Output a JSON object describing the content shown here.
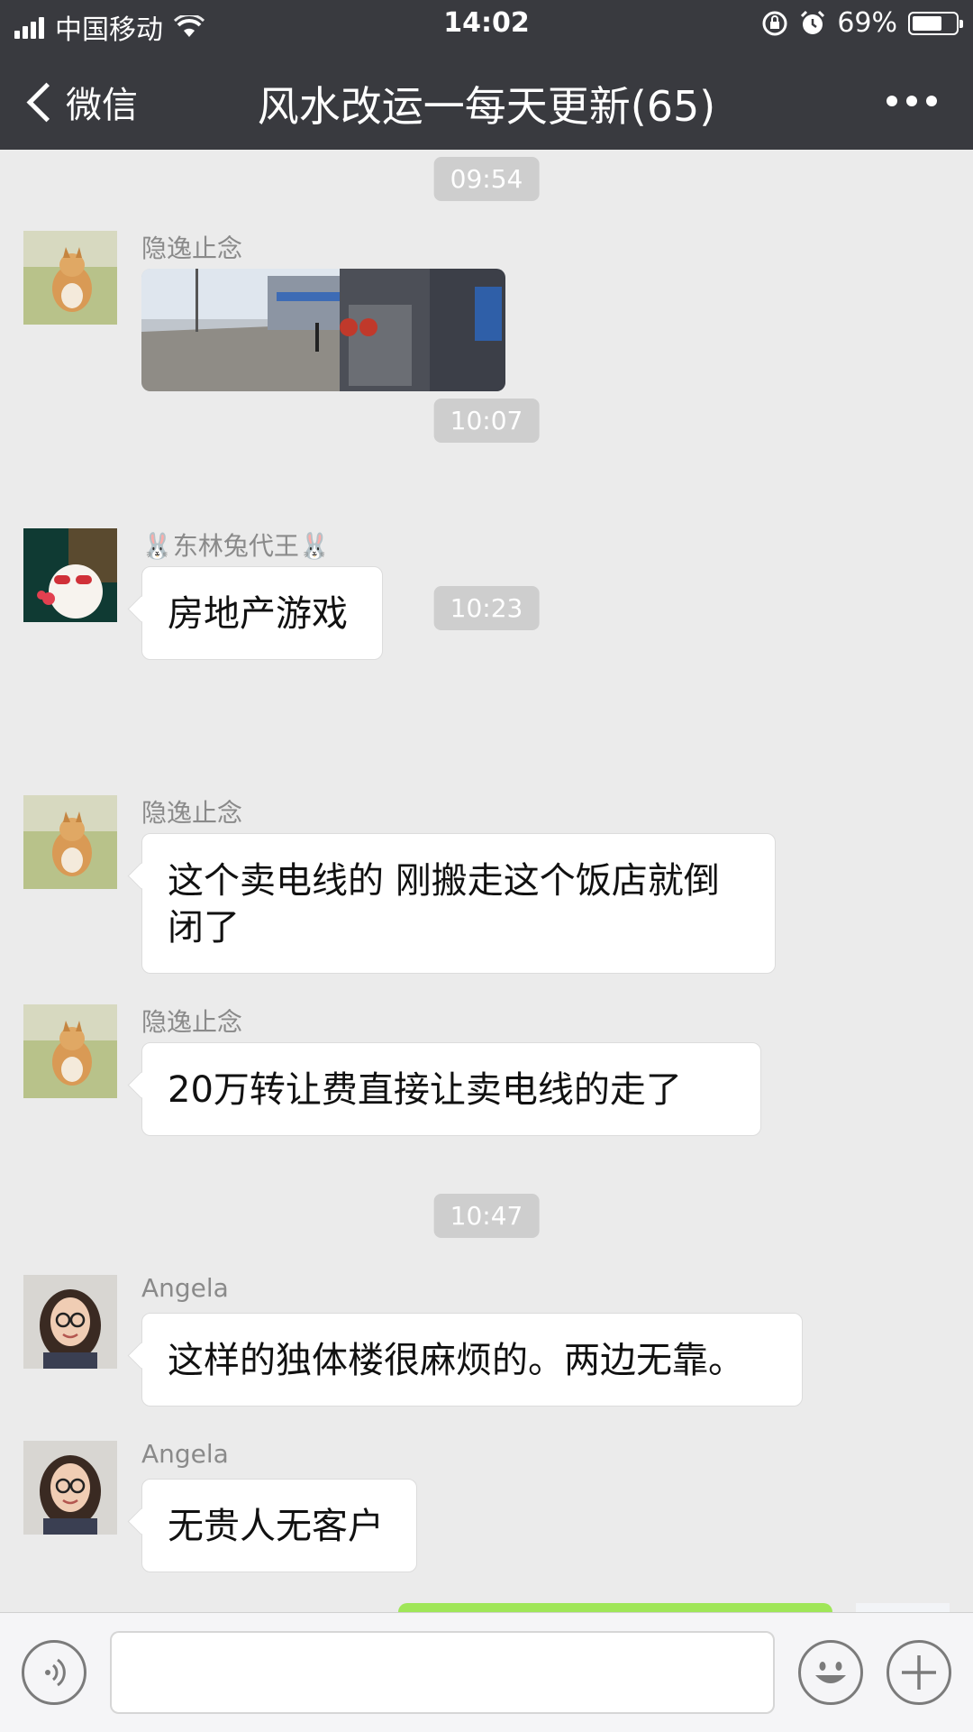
{
  "status_bar": {
    "carrier": "中国移动",
    "time": "14:02",
    "battery": "69%",
    "battery_level": 0.69
  },
  "nav": {
    "back_label": "微信",
    "title": "风水改运一每天更新(65)"
  },
  "chat": {
    "timestamps": [
      "09:54",
      "10:07",
      "10:23",
      "10:47"
    ],
    "messages": [
      {
        "sender": "隐逸止念",
        "type": "image"
      },
      {
        "sender": "🐰东林兔代王🐰",
        "text": "房地产游戏"
      },
      {
        "sender": "隐逸止念",
        "text": "这个卖电线的 刚搬走这个饭店就倒闭了"
      },
      {
        "sender": "隐逸止念",
        "text": "20万转让费直接让卖电线的走了"
      },
      {
        "sender": "Angela",
        "text": "这样的独体楼很麻烦的。两边无靠。"
      },
      {
        "sender": "Angela",
        "text": "无贵人无客户"
      }
    ]
  },
  "input_bar": {
    "voice_icon": "voice-icon",
    "emoji_icon": "emoji-icon",
    "plus_icon": "plus-icon"
  },
  "colors": {
    "header": "#393a3f",
    "chat_bg": "#ebebeb",
    "outgoing_bubble": "#9fe658"
  }
}
